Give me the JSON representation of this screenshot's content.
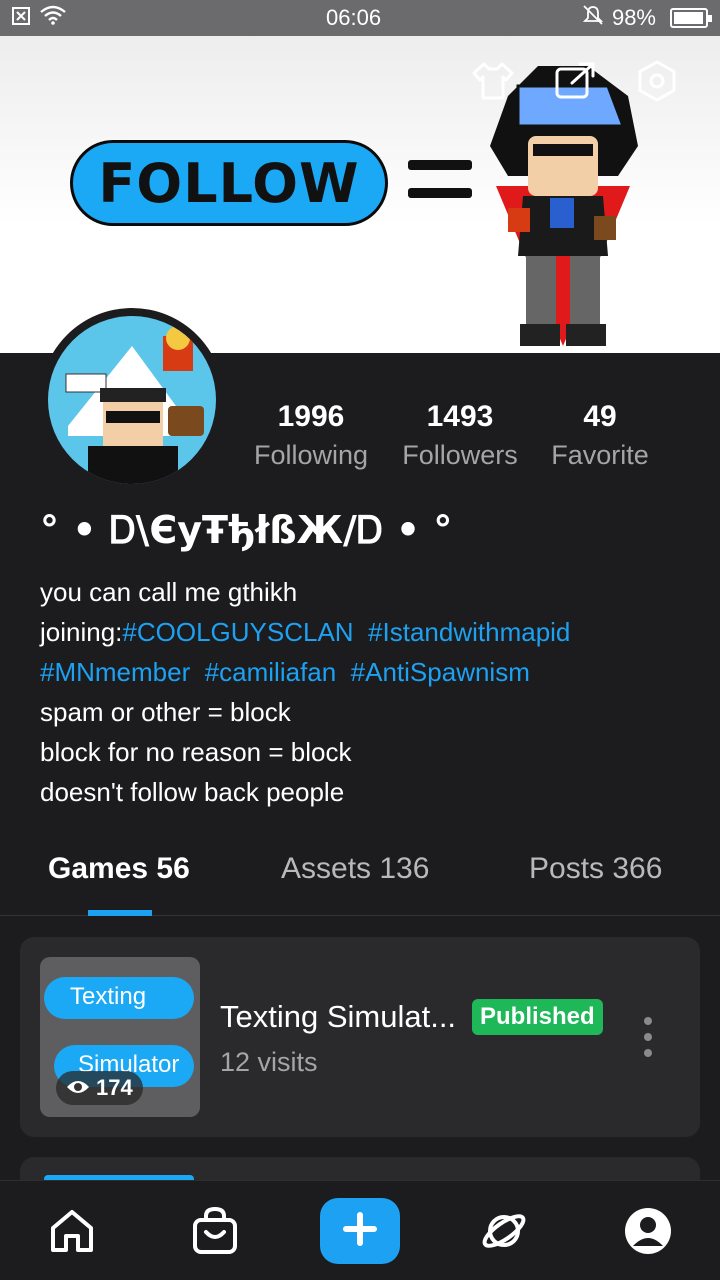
{
  "status_bar": {
    "time": "06:06",
    "battery": "98%",
    "battery_level": 0.98,
    "icons": [
      "screenshot-icon",
      "wifi-icon",
      "mute-icon",
      "battery-icon"
    ]
  },
  "banner": {
    "follow_text": "FOLLOW",
    "action_icons": [
      "shirt-icon",
      "share-icon",
      "settings-icon"
    ]
  },
  "profile": {
    "display_name": "° • Ꭰ\\ЄуŦђłßЖ/Ꭰ • °",
    "stats": [
      {
        "value": "1996",
        "label": "Following"
      },
      {
        "value": "1493",
        "label": "Followers"
      },
      {
        "value": "49",
        "label": "Favorite"
      }
    ],
    "bio": {
      "line1": "you can call me gthikh",
      "line2_prefix": "joining:",
      "tag1": "#COOLGUYSCLAN",
      "tag2": "#Istandwithmapid",
      "tag3": "#MNmember",
      "tag4": "#camiliafan",
      "tag5": "#AntiSpawnism",
      "line4": "spam or other = block",
      "line5": "block for no reason = block",
      "line6": "doesn't follow back people"
    }
  },
  "tabs": [
    {
      "label": "Games 56",
      "active": true
    },
    {
      "label": "Assets 136",
      "active": false
    },
    {
      "label": "Posts 366",
      "active": false
    }
  ],
  "games": [
    {
      "title": "Texting Simulat...",
      "status": "Published",
      "visits": "12 visits",
      "views": "174",
      "thumb_text_1": "Texting",
      "thumb_text_2": "Simulator"
    }
  ],
  "bottom_nav": [
    "home-icon",
    "shop-icon",
    "create-icon",
    "explore-icon",
    "profile-icon"
  ],
  "colors": {
    "accent": "#1da1f2",
    "published": "#1fb858",
    "background": "#1c1c1e",
    "card": "#2a2a2c"
  }
}
